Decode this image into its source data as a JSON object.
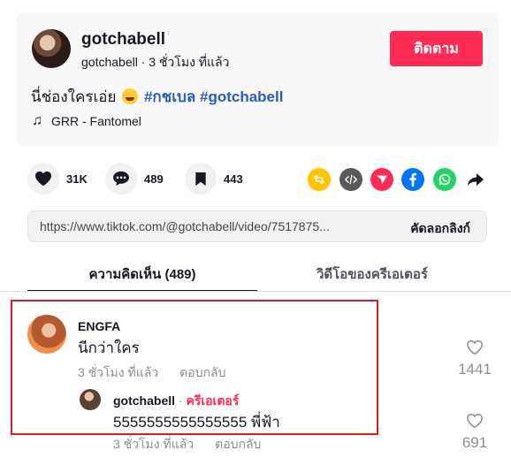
{
  "post": {
    "author_name": "gotchabell",
    "author_handle": "gotchabell",
    "time_sep": " · ",
    "time": "3 ชั่วโมง ที่แล้ว",
    "follow_label": "ติดตาม",
    "caption_text": "นี่ช่องใครเอ่ย",
    "caption_emoji": "laughing-emoji",
    "hashtags": [
      "#กชเบล",
      "#gotchabell"
    ],
    "music": "GRR - Fantomel"
  },
  "actions": {
    "likes": "31K",
    "comments": "489",
    "saves": "443"
  },
  "share_icons": [
    {
      "name": "repost-icon",
      "color": "#ffc300"
    },
    {
      "name": "embed-icon",
      "color": "#5a5a5a"
    },
    {
      "name": "send-icon",
      "color": "#fe2c55"
    },
    {
      "name": "facebook-icon",
      "color": "#0075fa"
    },
    {
      "name": "whatsapp-icon",
      "color": "#25d366"
    },
    {
      "name": "share-arrow-icon",
      "color": "#161823"
    }
  ],
  "link": {
    "url": "https://www.tiktok.com/@gotchabell/video/7517875...",
    "copy_label": "คัดลอกลิงก์"
  },
  "tabs": {
    "comments_label": "ความคิดเห็น (489)",
    "creator_videos_label": "วิดีโอของครีเอเตอร์"
  },
  "comment": {
    "name": "ENGFA",
    "text": "นีกว่าใคร",
    "time": "3 ชั่วโมง ที่แล้ว",
    "reply_label": "ตอบกลับ",
    "likes": "1441"
  },
  "reply": {
    "name": "gotchabell",
    "separator": " · ",
    "creator_label": "ครีเอเตอร์",
    "text": "5555555555555555 พี่ฟ้า",
    "time": "3 ชั่วโมง ที่แล้ว",
    "reply_label": "ตอบกลับ",
    "likes": "691"
  },
  "colors": {
    "accent": "#fe2c55",
    "hashtag": "#2b5db9",
    "highlight_border": "#d21f26"
  }
}
